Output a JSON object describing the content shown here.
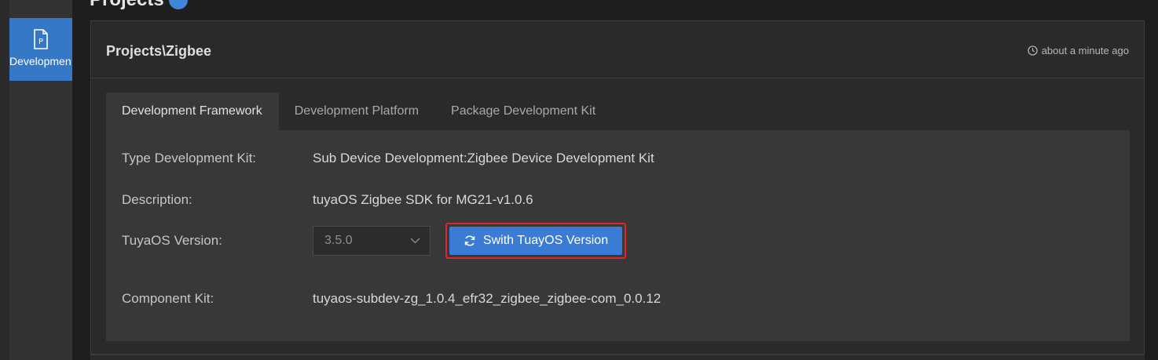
{
  "activity_bar": {
    "active_item_label": "Developmen"
  },
  "page_heading": "Projects",
  "panel": {
    "title": "Projects\\Zigbee",
    "timestamp": "about a minute ago"
  },
  "tabs": [
    {
      "label": "Development Framework",
      "active": true
    },
    {
      "label": "Development Platform",
      "active": false
    },
    {
      "label": "Package Development Kit",
      "active": false
    }
  ],
  "details": {
    "type_dev_kit_label": "Type Development Kit:",
    "type_dev_kit_value": "Sub Device Development:Zigbee Device Development Kit",
    "description_label": "Description:",
    "description_value": "tuyaOS Zigbee SDK for MG21-v1.0.6",
    "tuyaos_version_label": "TuyaOS Version:",
    "tuyaos_version_selected": "3.5.0",
    "switch_button_label": "Swith TuayOS Version",
    "component_kit_label": "Component Kit:",
    "component_kit_value": "tuyaos-subdev-zg_1.0.4_efr32_zigbee_zigbee-com_0.0.12"
  },
  "colors": {
    "accent": "#3a7bd5",
    "highlight_border": "#e0262a",
    "activity_active": "#3478c6"
  },
  "icons": {
    "activity": "project-icon",
    "timestamp": "clock-icon",
    "dropdown": "chevron-down-icon",
    "switch": "refresh-icon"
  }
}
